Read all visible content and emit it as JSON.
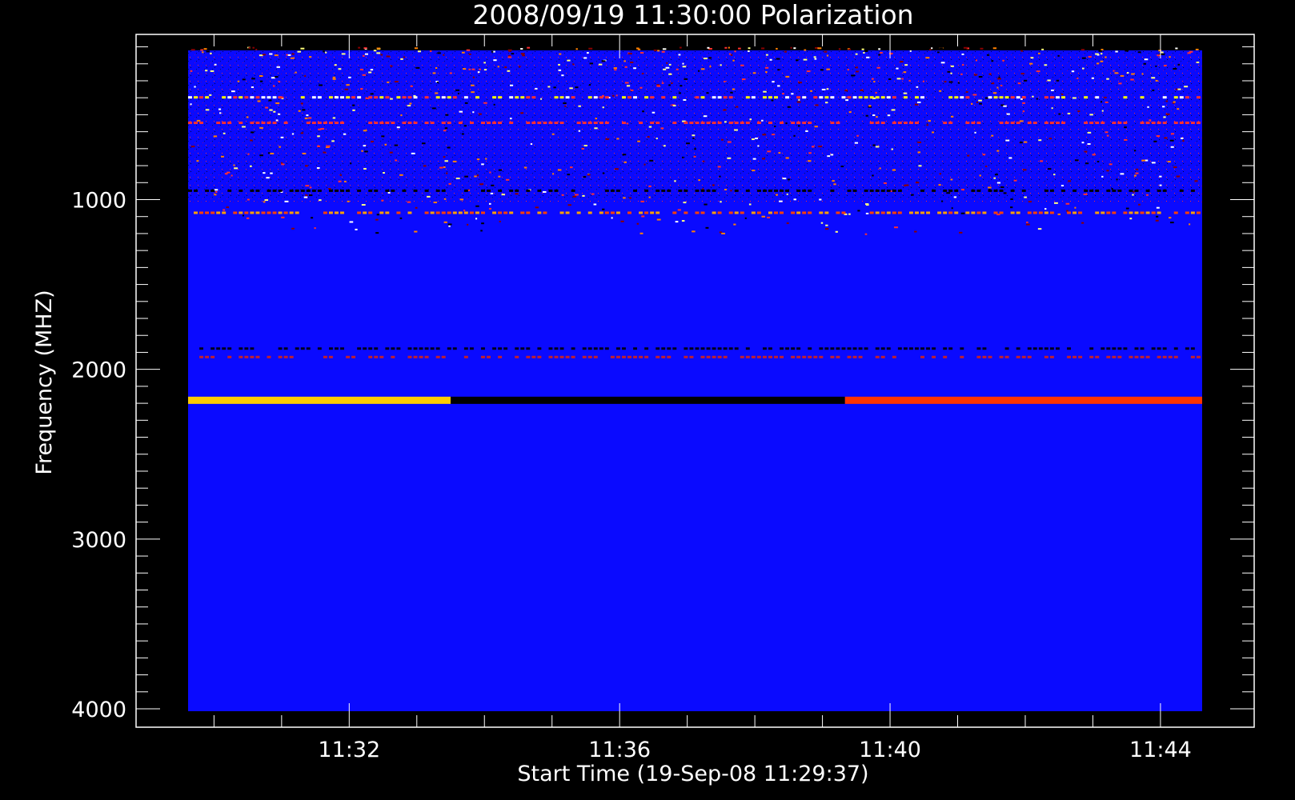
{
  "chart_data": {
    "type": "heatmap",
    "title": "2008/09/19 11:30:00 Polarization",
    "xlabel": "Start Time (19-Sep-08 11:29:37)",
    "ylabel": "Frequency (MHZ)",
    "x_range": [
      "11:29:37",
      "11:44:37"
    ],
    "x_ticks": [
      "11:32",
      "11:36",
      "11:40",
      "11:44"
    ],
    "y_range": [
      100,
      4000
    ],
    "y_inverted": true,
    "y_ticks": [
      1000,
      2000,
      3000,
      4000
    ],
    "colormap": [
      "#000000",
      "#0000ff",
      "#8b0000",
      "#ff0000",
      "#ffa500",
      "#ffff00",
      "#ffffff"
    ],
    "background_color": "#0a0aff",
    "bands": [
      {
        "freq_mhz": 400,
        "description": "strong bright band",
        "colors": [
          "#ffff00",
          "#ffffff",
          "#ff3030"
        ]
      },
      {
        "freq_mhz": 550,
        "description": "red streak",
        "colors": [
          "#ff3030"
        ]
      },
      {
        "freq_mhz": 950,
        "description": "dark band",
        "colors": [
          "#000000"
        ]
      },
      {
        "freq_mhz": 1080,
        "description": "dotted red/orange",
        "colors": [
          "#ff4000",
          "#ffa000"
        ]
      },
      {
        "freq_mhz": 1880,
        "description": "faint dark line",
        "colors": [
          "#000020"
        ]
      },
      {
        "freq_mhz": 1930,
        "description": "faint red/dark line",
        "colors": [
          "#c02030"
        ]
      },
      {
        "freq_mhz": 2180,
        "description": "main band",
        "segments": [
          {
            "from": "11:29:37",
            "to": "11:33:30",
            "color": "#ffcc00"
          },
          {
            "from": "11:33:30",
            "to": "11:39:20",
            "color": "#000000"
          },
          {
            "from": "11:39:20",
            "to": "11:44:37",
            "color": "#ff3300"
          }
        ]
      }
    ]
  }
}
